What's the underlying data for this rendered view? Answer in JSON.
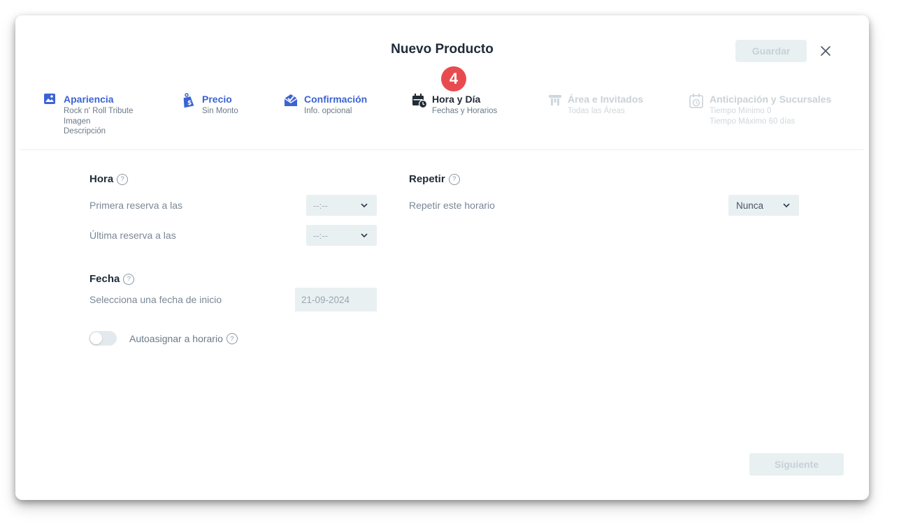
{
  "modal": {
    "title": "Nuevo Producto",
    "save_label": "Guardar",
    "close_icon": "close-icon",
    "active_step_number": "4"
  },
  "steps": [
    {
      "label": "Apariencia",
      "sub": [
        "Rock n' Roll Tribute",
        "Imagen",
        "Descripción"
      ],
      "state": "done",
      "icon": "image-icon"
    },
    {
      "label": "Precio",
      "sub": [
        "Sin Monto"
      ],
      "state": "done",
      "icon": "price-tag-icon"
    },
    {
      "label": "Confirmación",
      "sub": [
        "Info. opcional"
      ],
      "state": "done",
      "icon": "mail-check-icon"
    },
    {
      "label": "Hora y Día",
      "sub": [
        "Fechas y Horarios"
      ],
      "state": "active",
      "icon": "calendar-clock-icon"
    },
    {
      "label": "Área e Invitados",
      "sub": [
        "Todas las Áreas"
      ],
      "state": "future",
      "icon": "table-icon"
    },
    {
      "label": "Anticipación y Sucursales",
      "sub": [
        "Tiempo Mínimo 0",
        "Tiempo Máximo 60 días"
      ],
      "state": "future",
      "icon": "calendar-timer-icon"
    }
  ],
  "hora": {
    "title": "Hora",
    "first_label": "Primera reserva a las",
    "first_value": "--:--",
    "last_label": "Última reserva a las",
    "last_value": "--:--"
  },
  "repetir": {
    "title": "Repetir",
    "label": "Repetir este horario",
    "value": "Nunca"
  },
  "fecha": {
    "title": "Fecha",
    "label": "Selecciona una fecha de inicio",
    "value": "21-09-2024"
  },
  "autoasignar": {
    "label": "Autoasignar a horario",
    "enabled": false
  },
  "footer": {
    "next_label": "Siguiente"
  },
  "help_glyph": "?",
  "colors": {
    "accent_blue": "#3b63d6",
    "badge_red": "#e84b4f",
    "disabled_bg": "#e9f0f2",
    "disabled_text": "#c4d2d8"
  }
}
